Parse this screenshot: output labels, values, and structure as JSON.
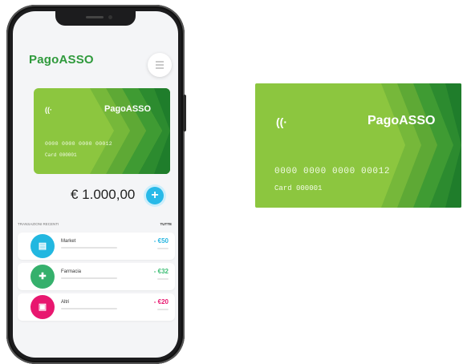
{
  "app": {
    "logo": "PagoASSO"
  },
  "card": {
    "brand": "PagoASSO",
    "contactless_symbol": "((·",
    "number": "0000 0000 0000 00012",
    "card_number": "Card 000001",
    "colors": {
      "base": "#8cc63f",
      "stripes": [
        "#76b83a",
        "#5ea935",
        "#3f9b33",
        "#2c8b2f",
        "#1f7d2b"
      ]
    }
  },
  "balance": {
    "amount": "€ 1.000,00",
    "add_symbol": "+"
  },
  "transactions": {
    "title": "TRANSAZIONI RECENTI",
    "all_label": "TUTTE",
    "items": [
      {
        "name": "Market",
        "amount": "- €50",
        "icon": "shop-icon",
        "glyph": "▤",
        "color": "#22b7e0",
        "amount_color": "#29b6e0"
      },
      {
        "name": "Farmacia",
        "amount": "- €32",
        "icon": "pharmacy-cross-icon",
        "glyph": "✚",
        "color": "#35b06c",
        "amount_color": "#3bbd73"
      },
      {
        "name": "Altri",
        "amount": "- €20",
        "icon": "other-icon",
        "glyph": "▣",
        "color": "#e8176f",
        "amount_color": "#e8176f"
      }
    ]
  },
  "menu_icon": "hamburger-icon"
}
